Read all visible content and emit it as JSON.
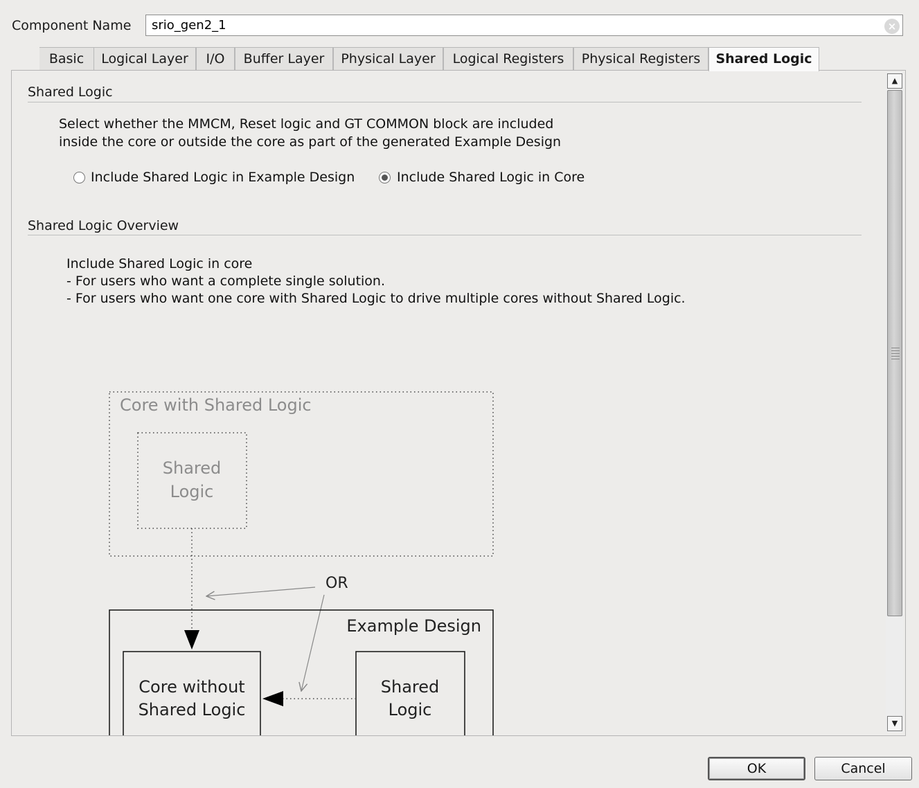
{
  "component": {
    "label": "Component Name",
    "value": "srio_gen2_1"
  },
  "tabs": [
    {
      "label": "Basic",
      "active": false
    },
    {
      "label": "Logical Layer",
      "active": false
    },
    {
      "label": "I/O",
      "active": false
    },
    {
      "label": "Buffer Layer",
      "active": false
    },
    {
      "label": "Physical Layer",
      "active": false
    },
    {
      "label": "Logical Registers",
      "active": false
    },
    {
      "label": "Physical Registers",
      "active": false
    },
    {
      "label": "Shared Logic",
      "active": true
    }
  ],
  "shared_logic": {
    "title": "Shared Logic",
    "description_line1": "Select whether the MMCM, Reset logic and GT COMMON block are included",
    "description_line2": "inside the core or outside the core as part of the generated Example Design",
    "options": [
      {
        "label": "Include Shared Logic in Example Design",
        "selected": false
      },
      {
        "label": "Include Shared Logic in Core",
        "selected": true
      }
    ]
  },
  "overview": {
    "title": "Shared Logic Overview",
    "line1": "Include Shared Logic in core",
    "line2": "- For users who want a complete single solution.",
    "line3": "- For users who want one core with Shared Logic to drive multiple cores without Shared Logic."
  },
  "diagram": {
    "core_with_shared": "Core with Shared Logic",
    "shared_logic_top_line1": "Shared",
    "shared_logic_top_line2": "Logic",
    "or_label": "OR",
    "example_design": "Example Design",
    "core_without_line1": "Core without",
    "core_without_line2": "Shared Logic",
    "shared_logic_bottom_line1": "Shared",
    "shared_logic_bottom_line2": "Logic"
  },
  "buttons": {
    "ok": "OK",
    "cancel": "Cancel"
  }
}
